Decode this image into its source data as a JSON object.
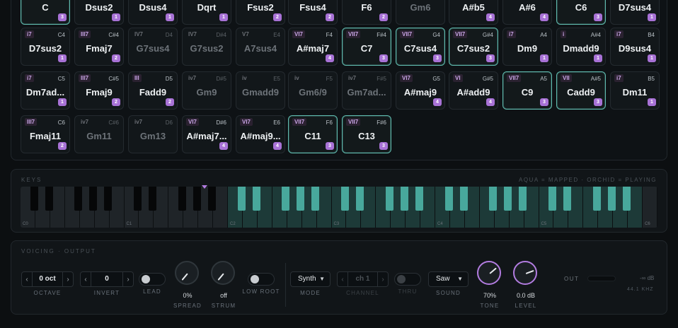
{
  "chord_grid": [
    [
      {
        "name": "C",
        "degree": "",
        "root": "",
        "badge": "3",
        "mapped": true,
        "dim": false
      },
      {
        "name": "Dsus2",
        "degree": "",
        "root": "",
        "badge": "1",
        "mapped": false,
        "dim": false
      },
      {
        "name": "Dsus4",
        "degree": "",
        "root": "",
        "badge": "1",
        "mapped": false,
        "dim": false
      },
      {
        "name": "Dqrt",
        "degree": "",
        "root": "",
        "badge": "1",
        "mapped": false,
        "dim": false
      },
      {
        "name": "Fsus2",
        "degree": "",
        "root": "",
        "badge": "2",
        "mapped": false,
        "dim": false
      },
      {
        "name": "Fsus4",
        "degree": "",
        "root": "",
        "badge": "2",
        "mapped": false,
        "dim": false
      },
      {
        "name": "F6",
        "degree": "",
        "root": "",
        "badge": "2",
        "mapped": false,
        "dim": false
      },
      {
        "name": "Gm6",
        "degree": "",
        "root": "",
        "badge": "",
        "mapped": false,
        "dim": true
      },
      {
        "name": "A#b5",
        "degree": "",
        "root": "",
        "badge": "4",
        "mapped": false,
        "dim": false
      },
      {
        "name": "A#6",
        "degree": "",
        "root": "",
        "badge": "4",
        "mapped": false,
        "dim": false
      },
      {
        "name": "C6",
        "degree": "",
        "root": "",
        "badge": "3",
        "mapped": true,
        "dim": false
      },
      {
        "name": "D7sus4",
        "degree": "",
        "root": "",
        "badge": "1",
        "mapped": false,
        "dim": false
      }
    ],
    [
      {
        "name": "D7sus2",
        "degree": "i7",
        "root": "C4",
        "badge": "1",
        "mapped": false,
        "dim": false
      },
      {
        "name": "Fmaj7",
        "degree": "III7",
        "root": "C#4",
        "badge": "2",
        "mapped": false,
        "dim": false
      },
      {
        "name": "G7sus4",
        "degree": "IV7",
        "root": "D4",
        "badge": "",
        "mapped": false,
        "dim": true
      },
      {
        "name": "G7sus2",
        "degree": "IV7",
        "root": "D#4",
        "badge": "",
        "mapped": false,
        "dim": true
      },
      {
        "name": "A7sus4",
        "degree": "V7",
        "root": "E4",
        "badge": "",
        "mapped": false,
        "dim": true
      },
      {
        "name": "A#maj7",
        "degree": "VI7",
        "root": "F4",
        "badge": "4",
        "mapped": false,
        "dim": false
      },
      {
        "name": "C7",
        "degree": "VII7",
        "root": "F#4",
        "badge": "3",
        "mapped": true,
        "dim": false
      },
      {
        "name": "C7sus4",
        "degree": "VII7",
        "root": "G4",
        "badge": "3",
        "mapped": true,
        "dim": false
      },
      {
        "name": "C7sus2",
        "degree": "VII7",
        "root": "G#4",
        "badge": "3",
        "mapped": true,
        "dim": false
      },
      {
        "name": "Dm9",
        "degree": "i7",
        "root": "A4",
        "badge": "1",
        "mapped": false,
        "dim": false
      },
      {
        "name": "Dmadd9",
        "degree": "i",
        "root": "A#4",
        "badge": "1",
        "mapped": false,
        "dim": false
      },
      {
        "name": "D9sus4",
        "degree": "i7",
        "root": "B4",
        "badge": "1",
        "mapped": false,
        "dim": false
      }
    ],
    [
      {
        "name": "Dm7ad...",
        "degree": "i7",
        "root": "C5",
        "badge": "1",
        "mapped": false,
        "dim": false
      },
      {
        "name": "Fmaj9",
        "degree": "III7",
        "root": "C#5",
        "badge": "2",
        "mapped": false,
        "dim": false
      },
      {
        "name": "Fadd9",
        "degree": "III",
        "root": "D5",
        "badge": "2",
        "mapped": false,
        "dim": false
      },
      {
        "name": "Gm9",
        "degree": "iv7",
        "root": "D#5",
        "badge": "",
        "mapped": false,
        "dim": true
      },
      {
        "name": "Gmadd9",
        "degree": "iv",
        "root": "E5",
        "badge": "",
        "mapped": false,
        "dim": true
      },
      {
        "name": "Gm6/9",
        "degree": "iv",
        "root": "F5",
        "badge": "",
        "mapped": false,
        "dim": true
      },
      {
        "name": "Gm7ad...",
        "degree": "iv7",
        "root": "F#5",
        "badge": "",
        "mapped": false,
        "dim": true
      },
      {
        "name": "A#maj9",
        "degree": "VI7",
        "root": "G5",
        "badge": "4",
        "mapped": false,
        "dim": false
      },
      {
        "name": "A#add9",
        "degree": "VI",
        "root": "G#5",
        "badge": "4",
        "mapped": false,
        "dim": false
      },
      {
        "name": "C9",
        "degree": "VII7",
        "root": "A5",
        "badge": "3",
        "mapped": true,
        "dim": false
      },
      {
        "name": "Cadd9",
        "degree": "VII",
        "root": "A#5",
        "badge": "3",
        "mapped": true,
        "dim": false
      },
      {
        "name": "Dm11",
        "degree": "i7",
        "root": "B5",
        "badge": "1",
        "mapped": false,
        "dim": false
      }
    ],
    [
      {
        "name": "Fmaj11",
        "degree": "III7",
        "root": "C6",
        "badge": "2",
        "mapped": false,
        "dim": false
      },
      {
        "name": "Gm11",
        "degree": "iv7",
        "root": "C#6",
        "badge": "",
        "mapped": false,
        "dim": true
      },
      {
        "name": "Gm13",
        "degree": "iv7",
        "root": "D6",
        "badge": "",
        "mapped": false,
        "dim": true
      },
      {
        "name": "A#maj7...",
        "degree": "VI7",
        "root": "D#6",
        "badge": "4",
        "mapped": false,
        "dim": false
      },
      {
        "name": "A#maj9...",
        "degree": "VI7",
        "root": "E6",
        "badge": "4",
        "mapped": false,
        "dim": false
      },
      {
        "name": "C11",
        "degree": "VII7",
        "root": "F6",
        "badge": "3",
        "mapped": true,
        "dim": false
      },
      {
        "name": "C13",
        "degree": "VII7",
        "root": "F#6",
        "badge": "3",
        "mapped": true,
        "dim": false
      }
    ]
  ],
  "keys": {
    "title": "KEYS",
    "legend": "AQUA = MAPPED · ORCHID = PLAYING",
    "octave_labels": [
      "C0",
      "C1",
      "C2",
      "C3",
      "C4",
      "C5",
      "C6",
      "C7"
    ],
    "mapped_from_octave": 2,
    "mapped_to_octave": 6
  },
  "output": {
    "title": "VOICING · OUTPUT",
    "octave": {
      "value": "0 oct",
      "label": "OCTAVE"
    },
    "invert": {
      "value": "0",
      "label": "INVERT"
    },
    "lead": {
      "label": "LEAD",
      "on": false
    },
    "spread": {
      "value": "0%",
      "label": "SPREAD"
    },
    "strum": {
      "value": "off",
      "label": "STRUM"
    },
    "low_root": {
      "label": "LOW ROOT",
      "on": false
    },
    "mode": {
      "value": "Synth",
      "label": "MODE"
    },
    "channel": {
      "value": "ch 1",
      "label": "CHANNEL"
    },
    "thru": {
      "label": "THRU",
      "on": false
    },
    "sound": {
      "value": "Saw",
      "label": "SOUND"
    },
    "tone": {
      "value": "70%",
      "label": "TONE",
      "level": 0.7
    },
    "level": {
      "value": "0.0 dB",
      "label": "LEVEL",
      "level": 0.75
    },
    "out_label": "OUT",
    "out_db": "-∞ dB",
    "sample_rate": "44.1 KHZ"
  },
  "colors": {
    "aqua": "#48a89c",
    "orchid": "#a872d6"
  }
}
